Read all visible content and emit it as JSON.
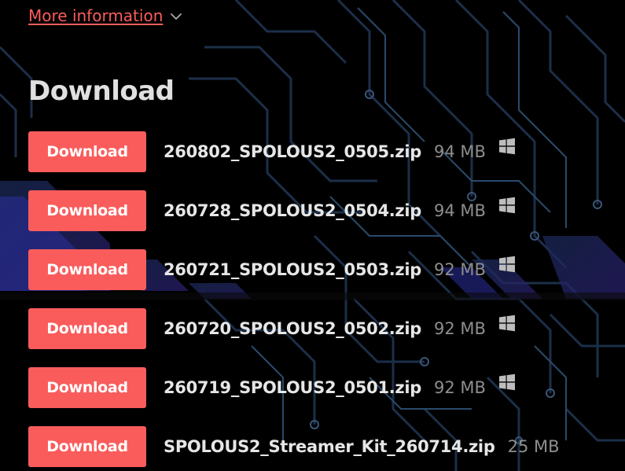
{
  "more_info": {
    "label": "More information",
    "icon": "chevron-down-icon"
  },
  "section": {
    "title": "Download"
  },
  "colors": {
    "accent": "#fa5c5c",
    "heading": "#e0e0e0",
    "filename": "#e6e6e6",
    "filesize": "#8e8e8e",
    "platform_icon": "#bdbdbd"
  },
  "downloads": [
    {
      "button_label": "Download",
      "file_name": "260802_SPOLOUS2_0505.zip",
      "size": "94 MB",
      "platform": "windows-icon"
    },
    {
      "button_label": "Download",
      "file_name": "260728_SPOLOUS2_0504.zip",
      "size": "94 MB",
      "platform": "windows-icon"
    },
    {
      "button_label": "Download",
      "file_name": "260721_SPOLOUS2_0503.zip",
      "size": "92 MB",
      "platform": "windows-icon"
    },
    {
      "button_label": "Download",
      "file_name": "260720_SPOLOUS2_0502.zip",
      "size": "92 MB",
      "platform": "windows-icon"
    },
    {
      "button_label": "Download",
      "file_name": "260719_SPOLOUS2_0501.zip",
      "size": "92 MB",
      "platform": "windows-icon"
    },
    {
      "button_label": "Download",
      "file_name": "SPOLOUS2_Streamer_Kit_260714.zip",
      "size": "25 MB",
      "platform": ""
    }
  ]
}
